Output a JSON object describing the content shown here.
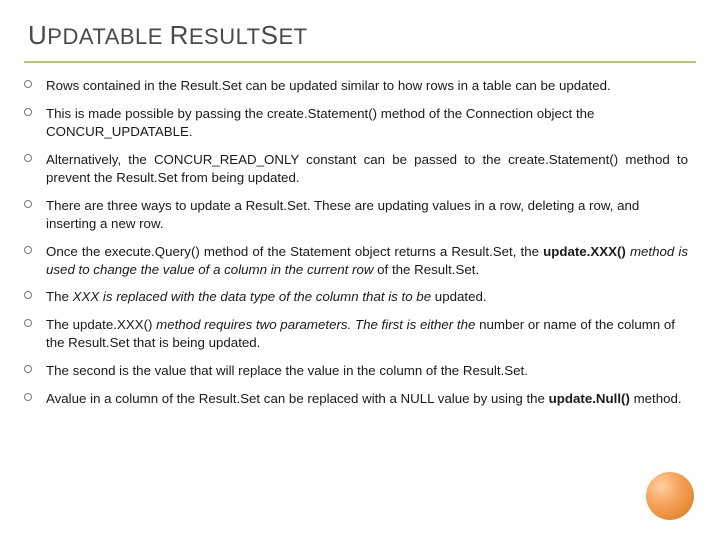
{
  "title_parts": {
    "u1": "U",
    "w1": "PDATABLE ",
    "u2": "R",
    "w2": "ESULT",
    "u3": "S",
    "w3": "ET"
  },
  "bullets": {
    "b1": "Rows contained in the Result.Set can be updated similar to how rows in a table can be updated.",
    "b2": "This is made possible by passing the create.Statement() method of the Connection object the CONCUR_UPDATABLE.",
    "b3": "Alternatively, the CONCUR_READ_ONLY constant can be passed to the create.Statement() method to prevent the Result.Set from being updated.",
    "b4": "There are three ways to update a Result.Set. These are updating values in a row, deleting a row, and inserting a new row.",
    "b5a": "Once the execute.Query() method of the Statement object returns a Result.Set, the ",
    "b5b": "update.XXX()",
    "b5c": " method is used to change the value of a column in the current row ",
    "b5d": "of the Result.Set.",
    "b6a": "The ",
    "b6b": "XXX is replaced with the data type of the column that is to be ",
    "b6c": "updated.",
    "b7a": "The update.XXX() ",
    "b7b": "method requires two parameters. The first is either the ",
    "b7c": "number or name of the column of the Result.Set that is being updated.",
    "b8": "The second is the value that will replace the value in the column of the Result.Set.",
    "b9a": "Avalue in a column of the Result.Set can be replaced with a NULL value by using the ",
    "b9b": "update.Null()",
    "b9c": " method."
  }
}
